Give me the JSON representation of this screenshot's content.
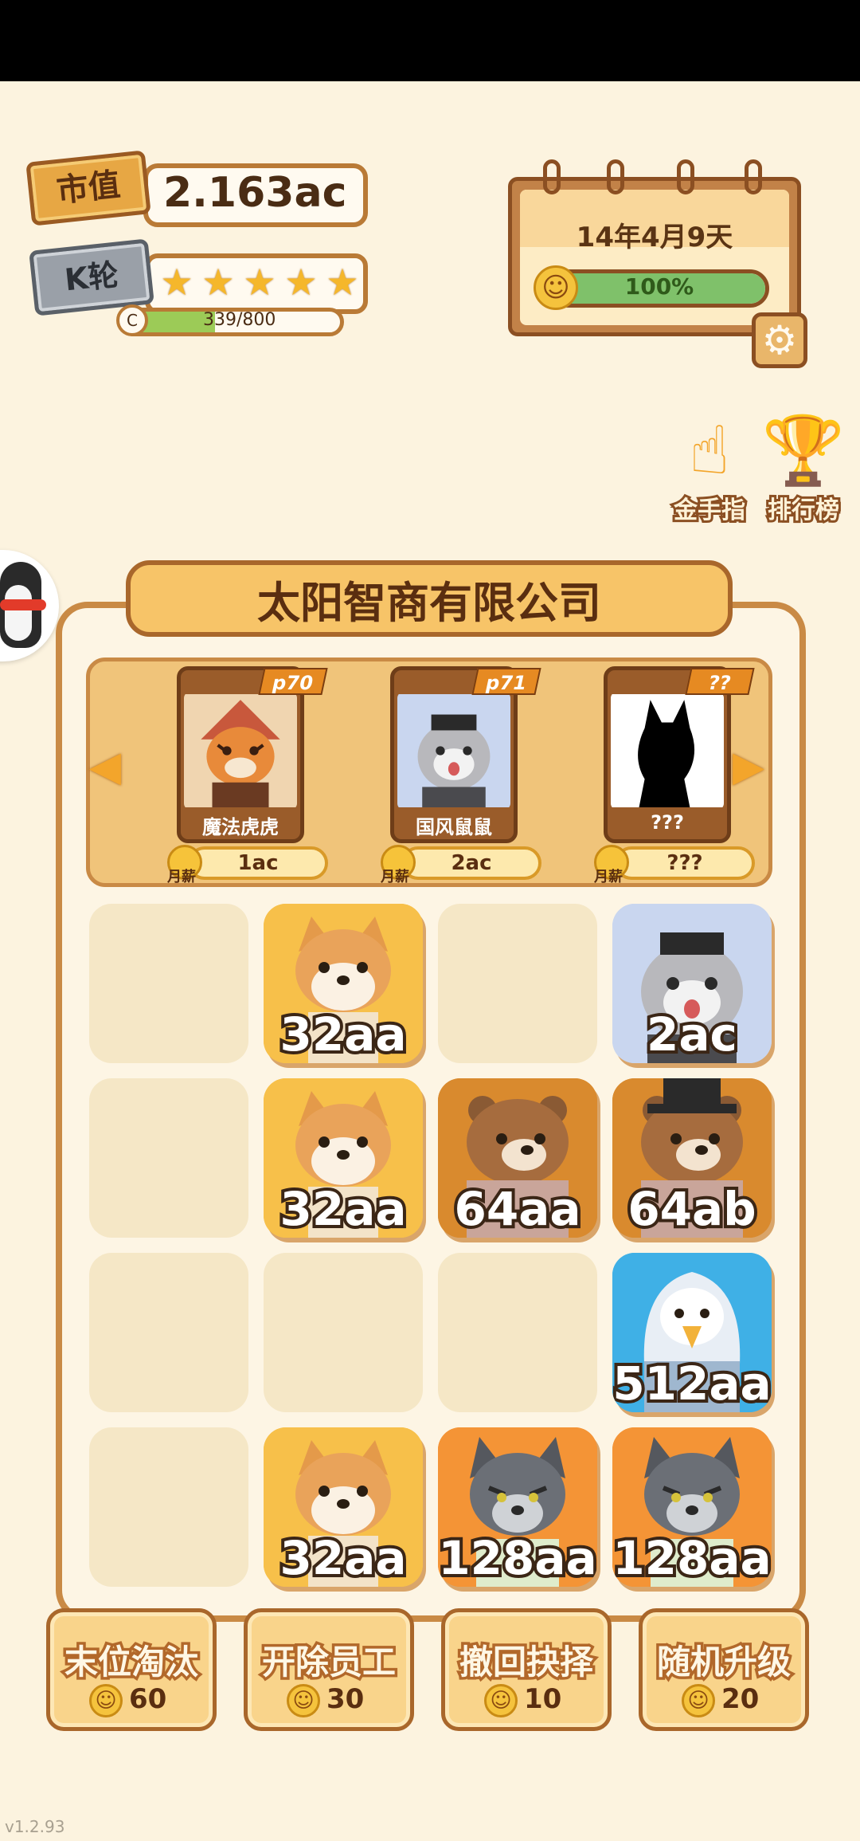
{
  "status": {
    "market_value_label": "市值",
    "market_value": "2.163ac",
    "rank_label": "K轮",
    "stars_filled": 5,
    "stars_total": 5,
    "xp_badge": "C",
    "xp_current": 339,
    "xp_max": 800,
    "xp_text": "339/800"
  },
  "calendar": {
    "date": "14年4月9天",
    "mood_percent": 100,
    "mood_text": "100%"
  },
  "side_tools": [
    {
      "label": "金手指",
      "icon": "golden-finger-icon"
    },
    {
      "label": "排行榜",
      "icon": "leaderboard-trophy-icon"
    }
  ],
  "company": {
    "name": "太阳智商有限公司"
  },
  "hire_cards": [
    {
      "tag": "p70",
      "name": "魔法虎虎",
      "salary": "1ac",
      "salary_label": "月薪",
      "portrait": "tiger"
    },
    {
      "tag": "p71",
      "name": "国风鼠鼠",
      "salary": "2ac",
      "salary_label": "月薪",
      "portrait": "hamster"
    },
    {
      "tag": "??",
      "name": "???",
      "salary": "???",
      "salary_label": "月薪",
      "portrait": "silhouette"
    }
  ],
  "grid": [
    [
      null,
      {
        "label": "32aa",
        "animal": "shiba"
      },
      null,
      {
        "label": "2ac",
        "animal": "hamster"
      }
    ],
    [
      null,
      {
        "label": "32aa",
        "animal": "shiba"
      },
      {
        "label": "64aa",
        "animal": "bear"
      },
      {
        "label": "64ab",
        "animal": "bear-tophat"
      }
    ],
    [
      null,
      null,
      null,
      {
        "label": "512aa",
        "animal": "eagle"
      }
    ],
    [
      null,
      {
        "label": "32aa",
        "animal": "shiba"
      },
      {
        "label": "128aa",
        "animal": "wolf"
      },
      {
        "label": "128aa",
        "animal": "wolf"
      }
    ]
  ],
  "actions": [
    {
      "label": "末位淘汰",
      "cost": "60"
    },
    {
      "label": "开除员工",
      "cost": "30"
    },
    {
      "label": "撤回抉择",
      "cost": "10"
    },
    {
      "label": "随机升级",
      "cost": "20"
    }
  ],
  "version": "v1.2.93",
  "colors": {
    "background": "#fcf3df",
    "board_border": "#c98a45",
    "tile_shiba": "#f7c04a",
    "tile_bear": "#d98a2e",
    "tile_hamster": "#c9d6ef",
    "tile_eagle": "#3fb0e6",
    "tile_wolf": "#f49436"
  }
}
